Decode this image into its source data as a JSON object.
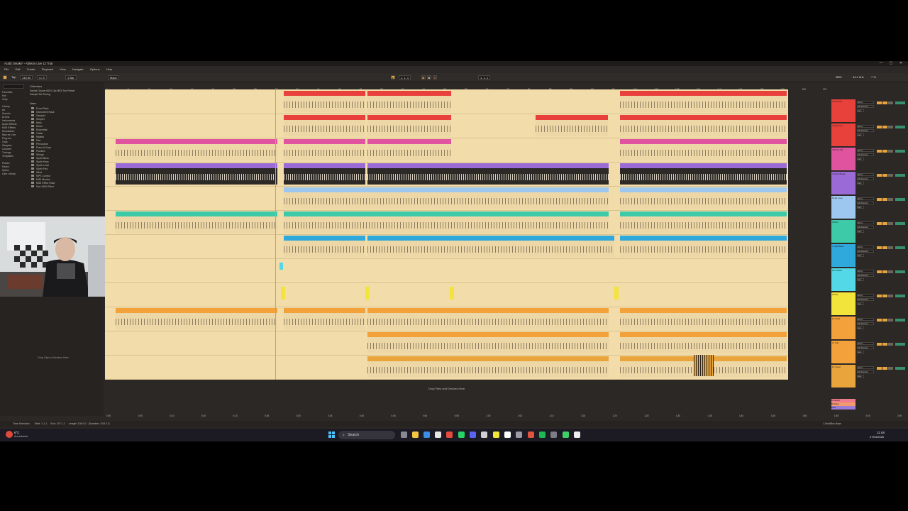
{
  "window": {
    "title": "Acidic breaks* - Ableton Live 12 Trial",
    "controls": [
      "—",
      "▢",
      "✕"
    ]
  },
  "menu": [
    "File",
    "Edit",
    "Create",
    "Playback",
    "View",
    "Navigate",
    "Options",
    "Help"
  ],
  "transport": {
    "tap_label": "Tap",
    "tempo": "140.00",
    "time_sig": "4 / 4",
    "quantize": "1 Bar",
    "follow_label": "Major",
    "position": "1. 1. 1",
    "loop_start": "1. 1. 1",
    "cpu_label": "MIDI",
    "sample_rate": "44.1 kHz",
    "cpu_load": "7 %"
  },
  "browser": {
    "tabs": [
      "Device",
      "Groove",
      "MIDI Clip",
      "MIDI Tool",
      "Preset",
      "Sample",
      "Set",
      "Tuning"
    ],
    "collections_header": "Collections",
    "side_items": [
      "Favorites",
      "Hot",
      "Grey",
      "",
      "Library",
      "All",
      "Sounds",
      "Drums",
      "Instruments",
      "Audio Effects",
      "MIDI Effects",
      "Modulators",
      "Max for Live",
      "Plug-Ins",
      "Clips",
      "Samples",
      "Grooves",
      "Tunings",
      "Templates",
      "",
      "Places",
      "Packs",
      "Splice",
      "User Library"
    ],
    "content_header": "Name",
    "list_items": [
      "Drum Rack",
      "Instrument Rack",
      "Sampler",
      "Simpler",
      "Bass",
      "Brass",
      "Ensemble",
      "Guitar",
      "Mallets",
      "Pad",
      "Percussive",
      "Piano & Keys",
      "Plucked",
      "Strings",
      "Synth Bass",
      "Synth Keys",
      "Synth Lead",
      "Synth Pad",
      "Wind",
      "MPE Control",
      "MIDI Monitor",
      "MIDI Effect Rack",
      "Max MIDI Effect"
    ],
    "drop_hint": "Drop Clips or Devices Here"
  },
  "ruler": {
    "bars": [
      "1",
      "5",
      "9",
      "13",
      "17",
      "21",
      "25",
      "29",
      "33",
      "37",
      "41",
      "45",
      "49",
      "53",
      "57",
      "61",
      "65",
      "69",
      "73",
      "77",
      "81",
      "85",
      "89",
      "93",
      "97",
      "101",
      "105",
      "109",
      "113",
      "117",
      "121",
      "125",
      "129",
      "133",
      "137"
    ],
    "times": [
      "0:00",
      "0:05",
      "0:10",
      "0:15",
      "0:20",
      "0:25",
      "0:30",
      "0:35",
      "0:40",
      "0:45",
      "0:50",
      "0:55",
      "1:00",
      "1:05",
      "1:10",
      "1:15",
      "1:20",
      "1:25",
      "1:30",
      "1:35",
      "1:40",
      "1:45",
      "1:50",
      "1:55",
      "2:00",
      "2:05",
      "2:10"
    ]
  },
  "arrangement": {
    "drop_files_hint": "Drop Files and Devices Here",
    "tracks": [
      {
        "name": "1 303 Acid",
        "color": "#e8403a"
      },
      {
        "name": "2 Acid Line",
        "color": "#e8403a"
      },
      {
        "name": "3 Break Fill",
        "color": "#e0549f"
      },
      {
        "name": "4 Chop Break",
        "color": "#9a6ad6"
      },
      {
        "name": "5 Hat Loop",
        "color": "#9ec7f0"
      },
      {
        "name": "6 Perc",
        "color": "#3dcaa8"
      },
      {
        "name": "7 Stab Bass",
        "color": "#2fa8dc"
      },
      {
        "name": "8 FX Riser",
        "color": "#52d8e6"
      },
      {
        "name": "9 Kick",
        "color": "#f2e43a"
      },
      {
        "name": "10 Lead",
        "color": "#f3a13a"
      },
      {
        "name": "11 Sub",
        "color": "#f3a13a"
      },
      {
        "name": "12 Vocal",
        "color": "#e9a43c"
      }
    ]
  },
  "mixer": {
    "in_label": "All Ins",
    "channel_label": "All Channels",
    "monitor": [
      "In",
      "Auto",
      "Off"
    ],
    "returns": [
      "A Reverb",
      "B Delay",
      "Main"
    ]
  },
  "status": {
    "left": "Time Selection",
    "start": "Start: 1.1.1",
    "end": "End: 137.1.1",
    "length": "Length: 136.0.0",
    "duration": "(Duration: 3:53.17)",
    "right": "1-MultiBus Bass"
  },
  "taskbar": {
    "weather": "6°C",
    "weather_sub": "Aurrinkoista",
    "search": "Search",
    "time": "11:48",
    "date": "27/04/2026"
  }
}
